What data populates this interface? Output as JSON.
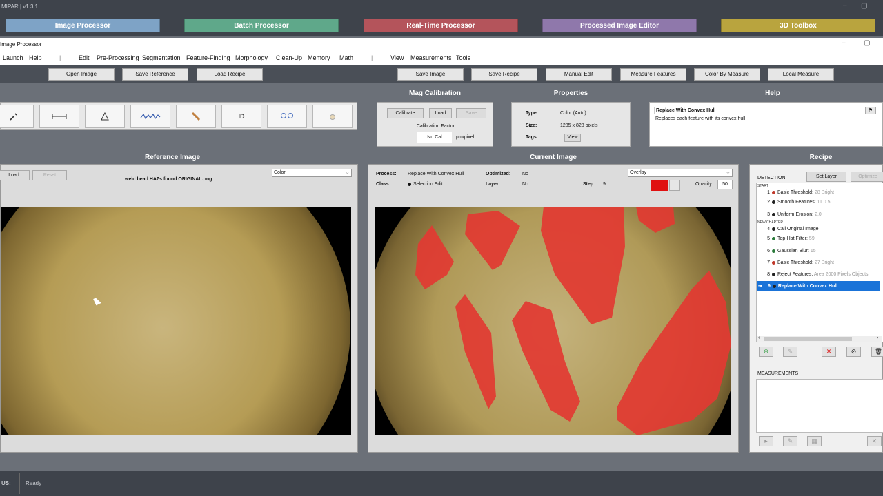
{
  "app": {
    "title": "MIPAR  |  v1.3.1",
    "window_title": "Image Processor"
  },
  "modules": [
    {
      "label": "Image Processor",
      "color": "#7ea3c6"
    },
    {
      "label": "Batch Processor",
      "color": "#5fa88a"
    },
    {
      "label": "Real-Time Processor",
      "color": "#b4545b"
    },
    {
      "label": "Processed Image Editor",
      "color": "#8f78ab"
    },
    {
      "label": "3D Toolbox",
      "color": "#b9a43e"
    }
  ],
  "menu": [
    "Launch",
    "Help",
    "Edit",
    "Pre-Processing",
    "Segmentation",
    "Feature-Finding",
    "Morphology",
    "Clean-Up",
    "Memory",
    "Math",
    "View",
    "Measurements",
    "Tools"
  ],
  "toolbar": [
    "Open Image",
    "Save Reference",
    "Load Recipe",
    "Save Image",
    "Save Recipe",
    "Manual Edit",
    "Measure Features",
    "Color By Measure",
    "Local Measure"
  ],
  "sections": {
    "mag": "Mag Calibration",
    "props": "Properties",
    "help": "Help",
    "ref": "Reference Image",
    "cur": "Current Image",
    "recipe": "Recipe"
  },
  "mag": {
    "calibrate": "Calibrate",
    "load": "Load",
    "save": "Save",
    "factor_label": "Calibration Factor",
    "factor_value": "No Cal",
    "unit": "µm/pixel"
  },
  "props": {
    "type_k": "Type:",
    "type_v": "Color (Auto)",
    "size_k": "Size:",
    "size_v": "1285 x 828 pixels",
    "tags_k": "Tags:",
    "tags_btn": "View"
  },
  "help": {
    "title": "Replace With Convex Hull",
    "text": "Replaces each feature with its convex hull."
  },
  "ref": {
    "load": "Load",
    "reset": "Reset",
    "filename": "weld bead HAZs found ORIGINAL.png",
    "mode": "Color"
  },
  "cur": {
    "process_k": "Process:",
    "process_v": "Replace With Convex Hull",
    "optimized_k": "Optimized:",
    "optimized_v": "No",
    "class_k": "Class:",
    "class_v": "Selection Edit",
    "layer_k": "Layer:",
    "layer_v": "No",
    "step_k": "Step:",
    "step_v": "9",
    "overlay": "Overlay",
    "overlay_color": "#e01010",
    "opacity_k": "Opacity:",
    "opacity_v": "50"
  },
  "recipe": {
    "detection": "DETECTION",
    "set_layer": "Set Layer",
    "optimize": "Optimize",
    "start": "START",
    "new_chapter": "NEW CHAPTER",
    "steps": [
      {
        "n": "1",
        "name": "Basic Threshold:",
        "param": "28 Bright",
        "color": "#c0392b"
      },
      {
        "n": "2",
        "name": "Smooth Features:",
        "param": "11 0.5",
        "color": "#222222"
      },
      {
        "n": "3",
        "name": "Uniform Erosion:",
        "param": "2.0",
        "color": "#222222"
      },
      {
        "n": "4",
        "name": "Call Original Image",
        "param": "",
        "color": "#222222"
      },
      {
        "n": "5",
        "name": "Top-Hat Filter:",
        "param": "59",
        "color": "#2a7a3a"
      },
      {
        "n": "6",
        "name": "Gaussian Blur:",
        "param": "15",
        "color": "#2a7a3a"
      },
      {
        "n": "7",
        "name": "Basic Threshold:",
        "param": "27 Bright",
        "color": "#c0392b"
      },
      {
        "n": "8",
        "name": "Reject Features:",
        "param": "Area 2000 Pixels Objects",
        "color": "#222222"
      },
      {
        "n": "9",
        "name": "Replace With Convex Hull",
        "param": "",
        "color": "#222222"
      }
    ],
    "measurements": "MEASUREMENTS"
  },
  "status": {
    "label": "US:",
    "text": "Ready"
  }
}
